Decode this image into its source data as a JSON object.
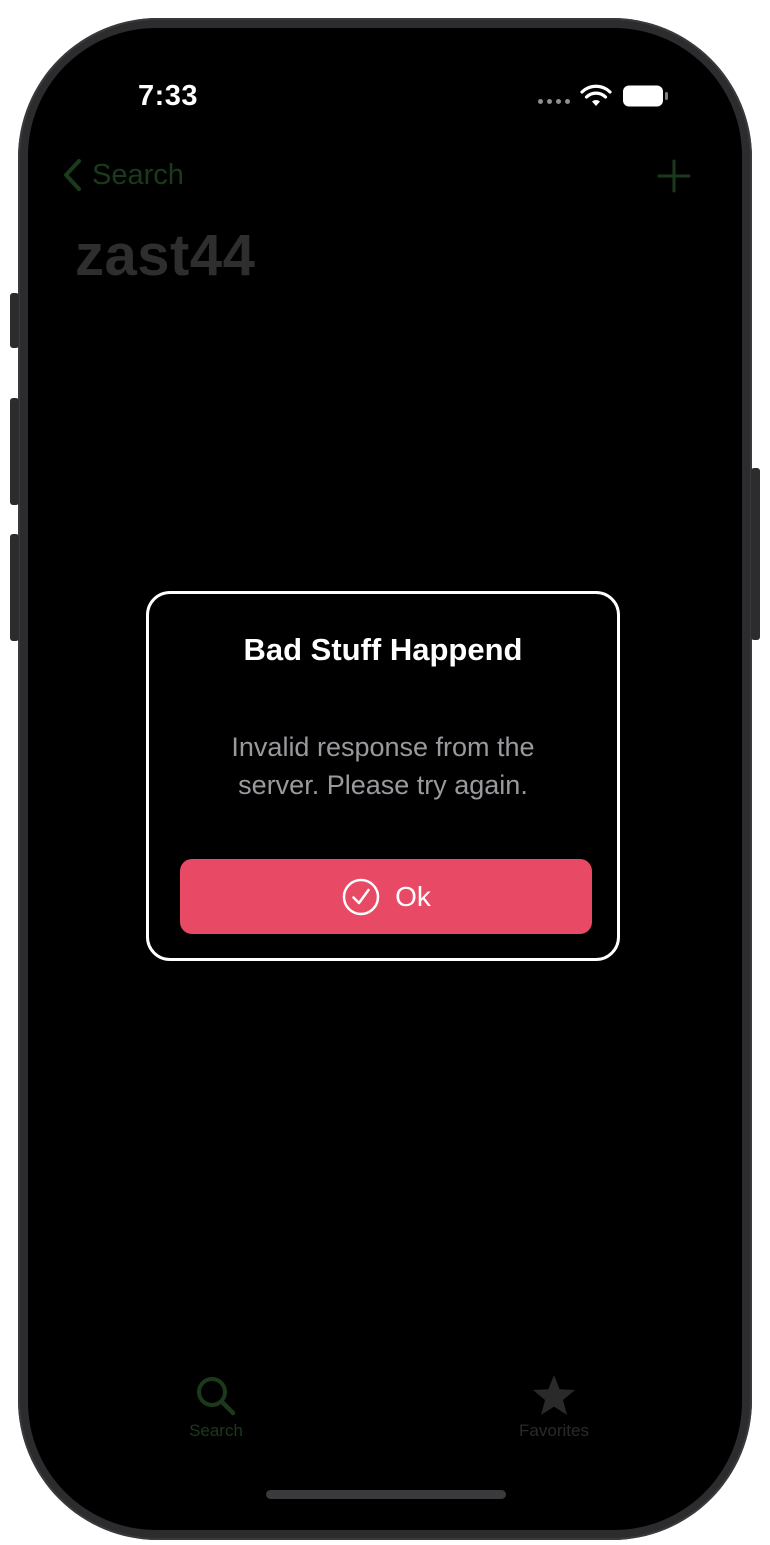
{
  "status_bar": {
    "time": "7:33",
    "icons": [
      "cellular-dots-icon",
      "wifi-icon",
      "battery-icon"
    ]
  },
  "nav_bar": {
    "back_label": "Search",
    "back_icon": "chevron-left-icon",
    "add_icon": "plus-icon",
    "title": "zast44"
  },
  "alert": {
    "title": "Bad Stuff Happend",
    "message": "Invalid response from the server. Please try again.",
    "button_label": "Ok",
    "button_icon": "checkmark-circle-icon",
    "button_color": "#e84a65"
  },
  "tab_bar": {
    "items": [
      {
        "label": "Search",
        "icon": "magnifying-glass-icon",
        "selected": true
      },
      {
        "label": "Favorites",
        "icon": "star-icon",
        "selected": false
      }
    ]
  },
  "colors": {
    "accent_dimmed": "#1b3a1b",
    "background": "#000000",
    "alert_border": "#ffffff"
  }
}
